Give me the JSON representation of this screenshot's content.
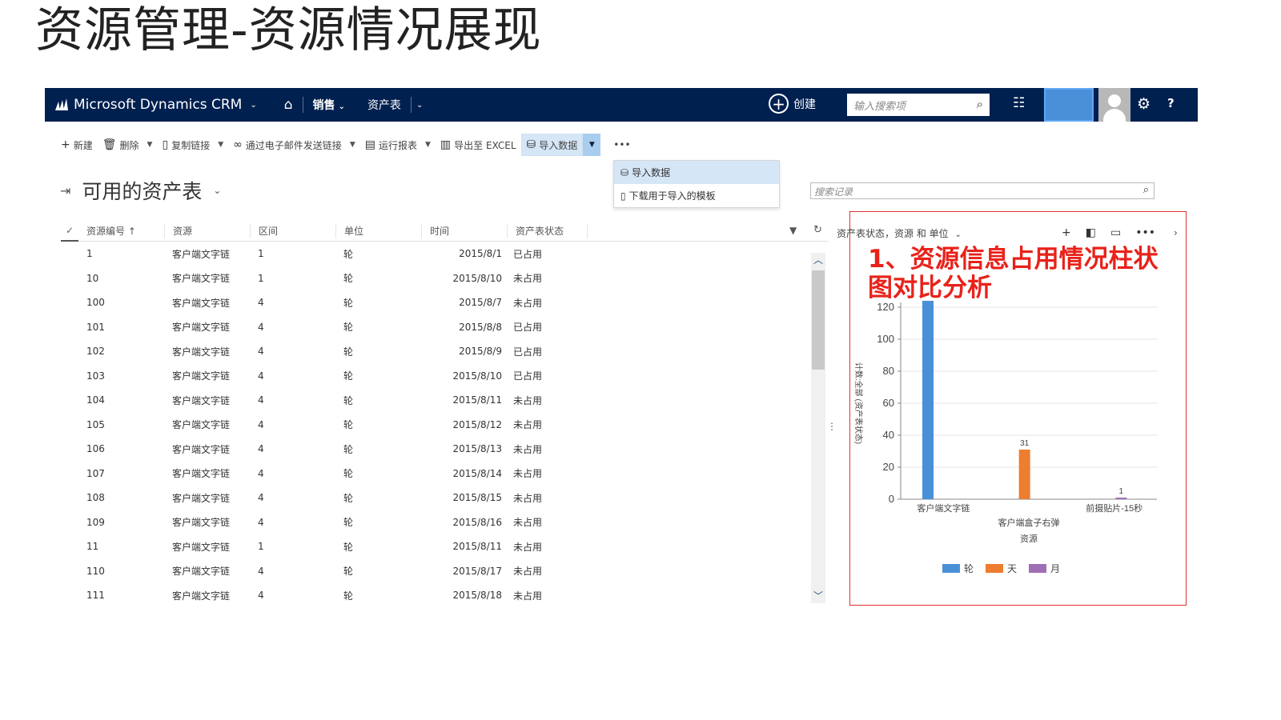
{
  "slide": {
    "title": "资源管理-资源情况展现"
  },
  "nav": {
    "app_name": "Microsoft Dynamics CRM",
    "module": "销售",
    "entity": "资产表",
    "create_label": "创建",
    "search_placeholder": "输入搜索项",
    "help": "?"
  },
  "commands": {
    "new": "新建",
    "delete": "删除",
    "copy_link": "复制链接",
    "email_link": "通过电子邮件发送链接",
    "run_report": "运行报表",
    "export_excel": "导出至 EXCEL",
    "import_data": "导入数据",
    "more": "•••"
  },
  "import_menu": {
    "items": [
      "导入数据",
      "下载用于导入的模板"
    ]
  },
  "view": {
    "title": "可用的资产表"
  },
  "record_search": {
    "placeholder": "搜索记录"
  },
  "grid": {
    "columns": [
      "资源编号 ↑",
      "资源",
      "区间",
      "单位",
      "时间",
      "资产表状态"
    ],
    "rows": [
      [
        "1",
        "客户端文字链",
        "1",
        "轮",
        "2015/8/1",
        "已占用"
      ],
      [
        "10",
        "客户端文字链",
        "1",
        "轮",
        "2015/8/10",
        "未占用"
      ],
      [
        "100",
        "客户端文字链",
        "4",
        "轮",
        "2015/8/7",
        "未占用"
      ],
      [
        "101",
        "客户端文字链",
        "4",
        "轮",
        "2015/8/8",
        "已占用"
      ],
      [
        "102",
        "客户端文字链",
        "4",
        "轮",
        "2015/8/9",
        "已占用"
      ],
      [
        "103",
        "客户端文字链",
        "4",
        "轮",
        "2015/8/10",
        "已占用"
      ],
      [
        "104",
        "客户端文字链",
        "4",
        "轮",
        "2015/8/11",
        "未占用"
      ],
      [
        "105",
        "客户端文字链",
        "4",
        "轮",
        "2015/8/12",
        "未占用"
      ],
      [
        "106",
        "客户端文字链",
        "4",
        "轮",
        "2015/8/13",
        "未占用"
      ],
      [
        "107",
        "客户端文字链",
        "4",
        "轮",
        "2015/8/14",
        "未占用"
      ],
      [
        "108",
        "客户端文字链",
        "4",
        "轮",
        "2015/8/15",
        "未占用"
      ],
      [
        "109",
        "客户端文字链",
        "4",
        "轮",
        "2015/8/16",
        "未占用"
      ],
      [
        "11",
        "客户端文字链",
        "1",
        "轮",
        "2015/8/11",
        "未占用"
      ],
      [
        "110",
        "客户端文字链",
        "4",
        "轮",
        "2015/8/17",
        "未占用"
      ],
      [
        "111",
        "客户端文字链",
        "4",
        "轮",
        "2015/8/18",
        "未占用"
      ]
    ]
  },
  "chart_panel": {
    "header": "资产表状态，资源 和 单位",
    "annotation": "1、资源信息占用情况柱状图对比分析"
  },
  "chart_data": {
    "type": "bar",
    "categories": [
      "客户端文字链",
      "客户端盒子右弹",
      "前摄贴片-15秒"
    ],
    "series": [
      {
        "name": "轮",
        "color": "#4a90d9",
        "values": [
          124,
          0,
          0
        ]
      },
      {
        "name": "天",
        "color": "#ed7d31",
        "values": [
          0,
          31,
          0
        ]
      },
      {
        "name": "月",
        "color": "#9e6fb5",
        "values": [
          0,
          0,
          1
        ]
      }
    ],
    "data_labels": [
      "124",
      "31",
      "1"
    ],
    "ylabel": "计数:全部 (资产表状态)",
    "xlabel": "资源",
    "ylim": [
      0,
      120
    ],
    "yticks": [
      "0",
      "20",
      "40",
      "60",
      "80",
      "100",
      "120"
    ],
    "grid": true,
    "legend": "bottom"
  }
}
